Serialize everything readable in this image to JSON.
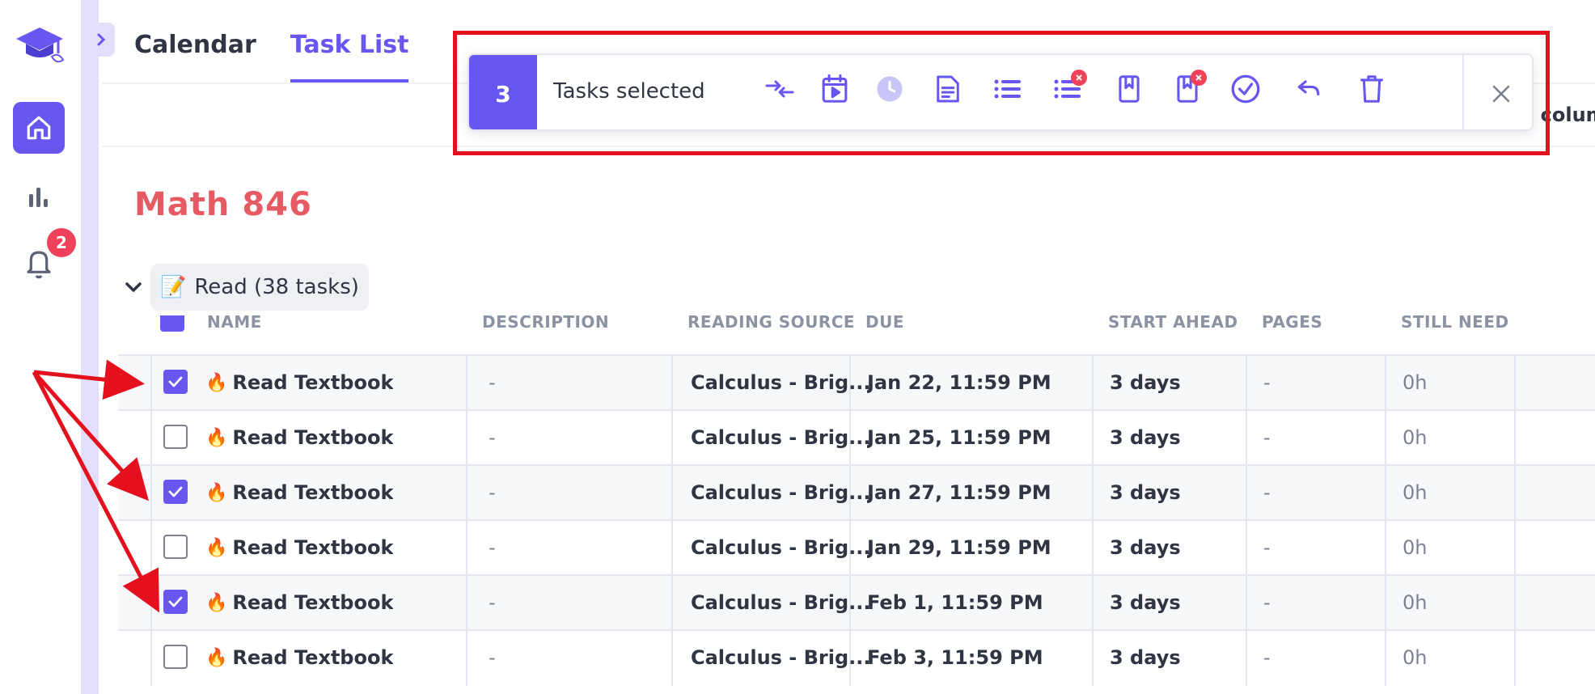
{
  "sidebar": {
    "notification_count": "2",
    "icons": [
      "graduation-cap-icon",
      "home-icon",
      "bar-chart-icon",
      "bell-icon"
    ]
  },
  "tabs": [
    {
      "label": "Calendar",
      "active": false
    },
    {
      "label": "Task List",
      "active": true
    }
  ],
  "header_right_text": "e colum",
  "toolbar": {
    "count": "3",
    "label": "Tasks selected",
    "icons": [
      "merge-arrows-icon",
      "calendar-play-icon",
      "clock-icon",
      "document-icon",
      "list-icon",
      "list-remove-icon",
      "bookmark-icon",
      "bookmark-remove-icon",
      "check-circle-icon",
      "undo-icon",
      "trash-icon"
    ]
  },
  "course_title": "Math 846",
  "group": {
    "emoji": "📝",
    "label": "Read (38 tasks)"
  },
  "columns": [
    "NAME",
    "DESCRIPTION",
    "READING SOURCE",
    "DUE",
    "START AHEAD",
    "PAGES",
    "STILL NEED"
  ],
  "rows": [
    {
      "checked": true,
      "name": "Read Textbook",
      "description": "-",
      "source": "Calculus - Brig...",
      "due": "Jan 22, 11:59 PM",
      "start_ahead": "3 days",
      "pages": "-",
      "still_need": "0h"
    },
    {
      "checked": false,
      "name": "Read Textbook",
      "description": "-",
      "source": "Calculus - Brig...",
      "due": "Jan 25, 11:59 PM",
      "start_ahead": "3 days",
      "pages": "-",
      "still_need": "0h"
    },
    {
      "checked": true,
      "name": "Read Textbook",
      "description": "-",
      "source": "Calculus - Brig...",
      "due": "Jan 27, 11:59 PM",
      "start_ahead": "3 days",
      "pages": "-",
      "still_need": "0h"
    },
    {
      "checked": false,
      "name": "Read Textbook",
      "description": "-",
      "source": "Calculus - Brig...",
      "due": "Jan 29, 11:59 PM",
      "start_ahead": "3 days",
      "pages": "-",
      "still_need": "0h"
    },
    {
      "checked": true,
      "name": "Read Textbook",
      "description": "-",
      "source": "Calculus - Brig...",
      "due": "Feb 1, 11:59 PM",
      "start_ahead": "3 days",
      "pages": "-",
      "still_need": "0h"
    },
    {
      "checked": false,
      "name": "Read Textbook",
      "description": "-",
      "source": "Calculus - Brig...",
      "due": "Feb 3, 11:59 PM",
      "start_ahead": "3 days",
      "pages": "-",
      "still_need": "0h"
    }
  ],
  "colors": {
    "accent": "#6757f0",
    "course_title": "#e55a63",
    "annotation_red": "#e4101e",
    "badge": "#f0415a"
  }
}
